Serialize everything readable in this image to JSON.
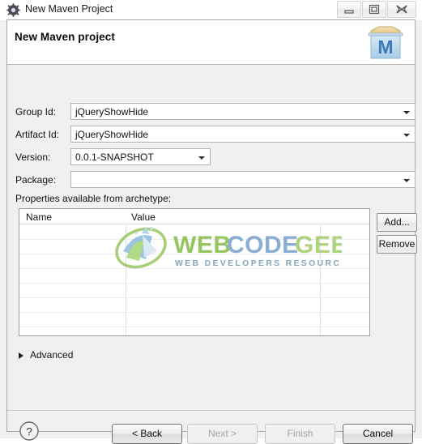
{
  "window": {
    "title": "New Maven Project",
    "title_icon": "gear-icon",
    "controls": {
      "minimize": "minimize-icon",
      "maximize": "restore-icon",
      "close": "close-icon"
    }
  },
  "header": {
    "title": "New Maven project",
    "icon": "maven-project-icon"
  },
  "form": {
    "fields": [
      {
        "label": "Group Id:",
        "value": "jQueryShowHide",
        "placeholder": "",
        "control": "combobox"
      },
      {
        "label": "Artifact Id:",
        "value": "jQueryShowHide",
        "placeholder": "",
        "control": "combobox"
      },
      {
        "label": "Version:",
        "value": "0.0.1-SNAPSHOT",
        "placeholder": "",
        "control": "combobox"
      },
      {
        "label": "Package:",
        "value": "",
        "placeholder": "",
        "control": "combobox"
      }
    ]
  },
  "properties": {
    "label": "Properties available from archetype:",
    "columns": [
      "Name",
      "Value"
    ],
    "rows": [],
    "buttons": {
      "add": "Add...",
      "remove": "Remove"
    }
  },
  "watermark": {
    "primary": "WEB CODE GEEKS",
    "secondary": "WEB DEVELOPERS RESOURCE CENTER"
  },
  "advanced": {
    "label": "Advanced",
    "expanded": false,
    "arrow_icon": "chevron-right-icon"
  },
  "footer": {
    "help_icon": "help-icon",
    "buttons": [
      {
        "label": "< Back",
        "enabled": true
      },
      {
        "label": "Next >",
        "enabled": false
      },
      {
        "label": "Finish",
        "enabled": false
      },
      {
        "label": "Cancel",
        "enabled": true
      }
    ]
  },
  "colors": {
    "watermark_green": "#8cc152",
    "watermark_blue": "#5b9bd5",
    "maven_blue": "#3a7ab8",
    "dialog_bg": "#f0f0f0"
  }
}
